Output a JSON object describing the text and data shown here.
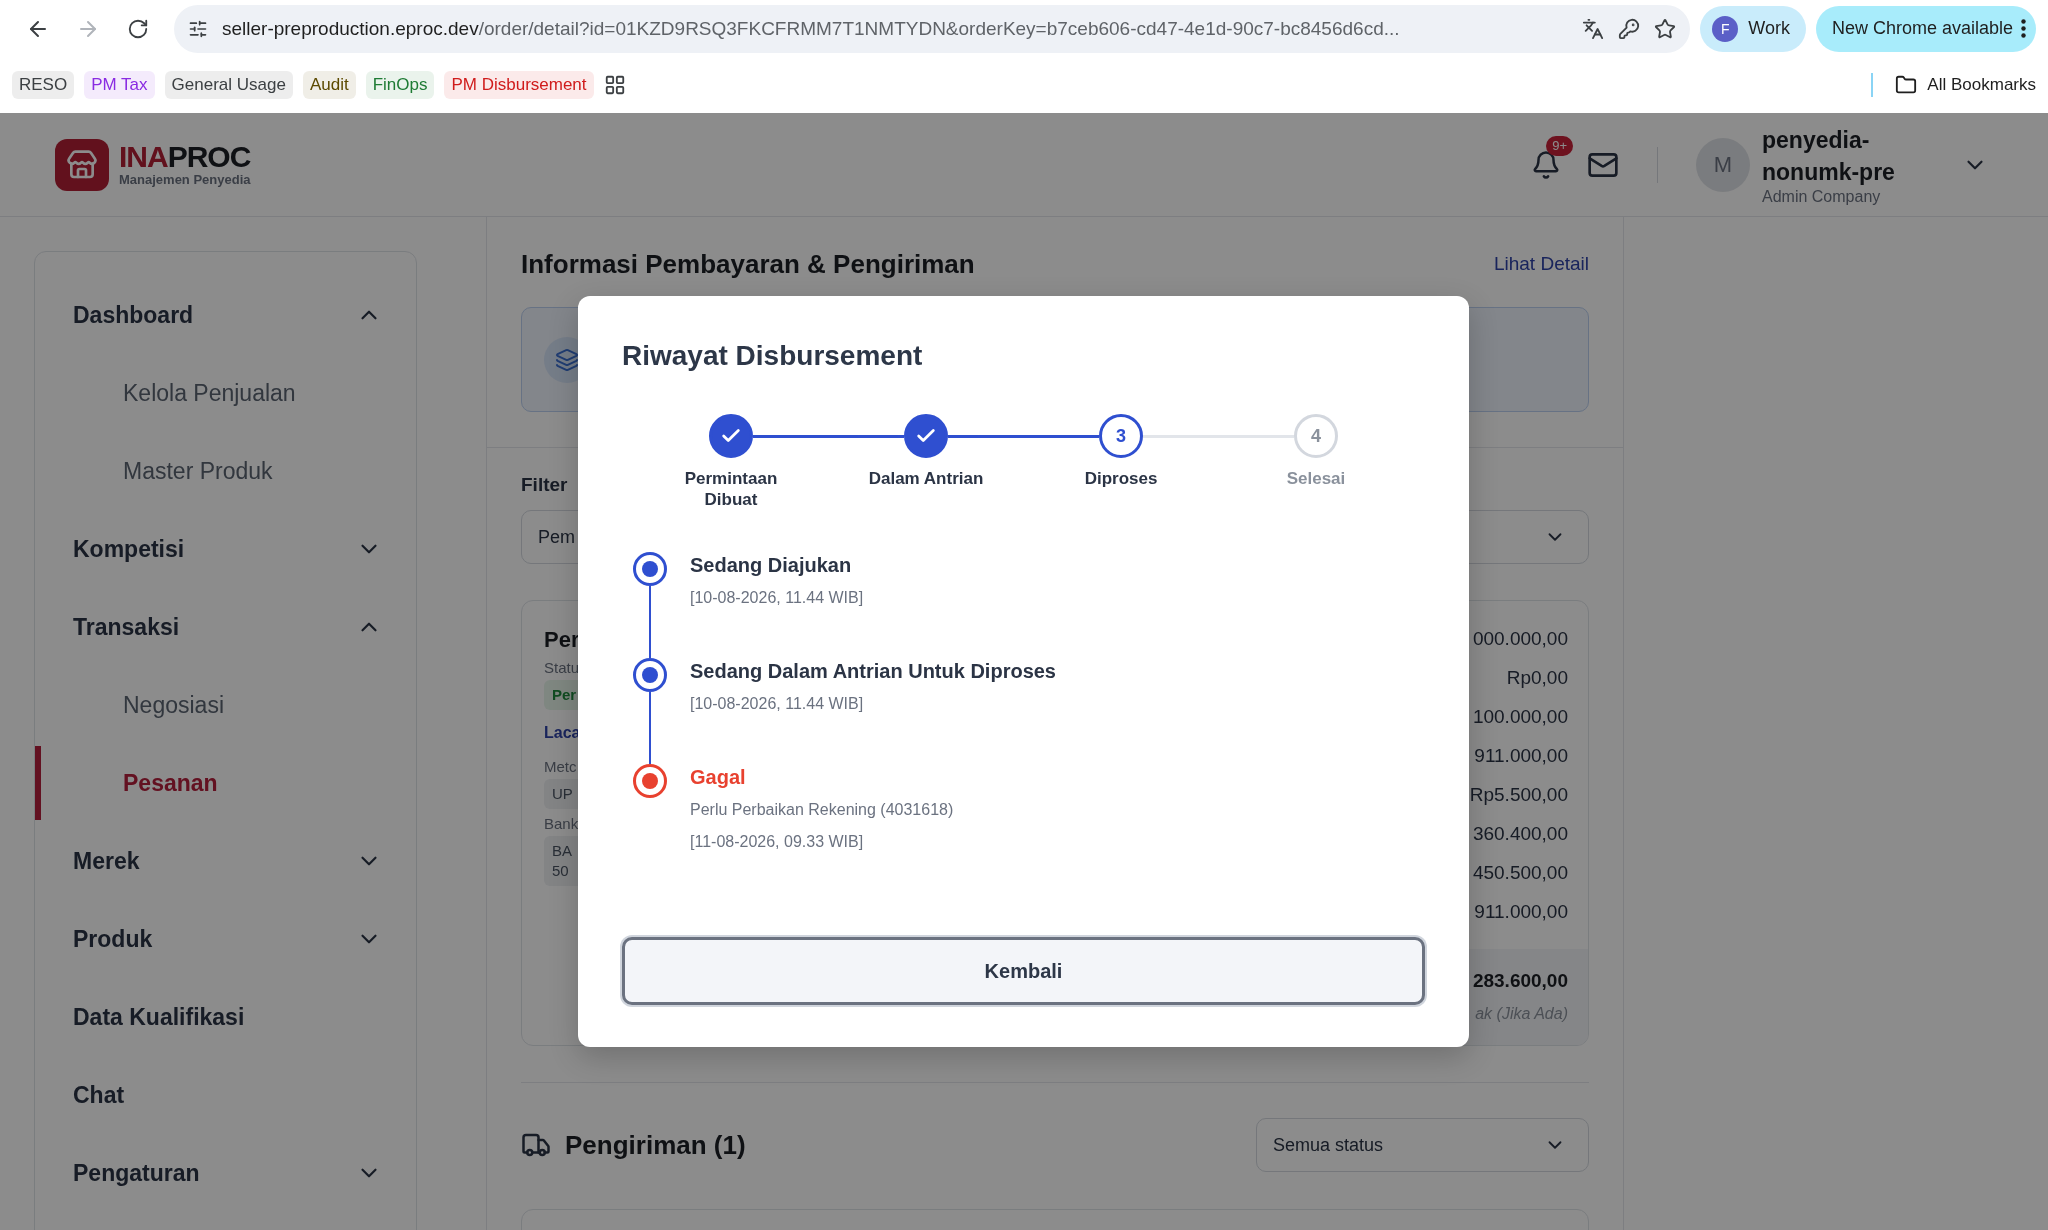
{
  "browser": {
    "url_host": "seller-preproduction.eproc.dev",
    "url_path": "/order/detail?id=01KZD9RSQ3FKCFRMM7T1NMTYDN&orderKey=b7ceb606-cd47-4e1d-90c7-bc8456d6cd...",
    "profile": {
      "initial": "F",
      "name": "Work"
    },
    "update_button": "New Chrome available",
    "bookmarks": [
      {
        "label": "RESO",
        "color": "#3c4043"
      },
      {
        "label": "PM Tax",
        "color": "#8a2be2"
      },
      {
        "label": "General Usage",
        "color": "#3c4043"
      },
      {
        "label": "Audit",
        "color": "#5c4a00"
      },
      {
        "label": "FinOps",
        "color": "#1e7b34"
      },
      {
        "label": "PM Disbursement",
        "color": "#d01c1c"
      }
    ],
    "all_bookmarks": "All Bookmarks"
  },
  "header": {
    "brand_accent": "INA",
    "brand": "PROC",
    "subtitle": "Manajemen Penyedia",
    "notification_badge": "9+",
    "user": {
      "avatar_initial": "M",
      "name": "penyedia-nonumk-pre",
      "role": "Admin Company"
    }
  },
  "sidebar": {
    "items": [
      {
        "label": "Dashboard",
        "kind": "group",
        "expanded": true,
        "selected": false,
        "children": [
          {
            "label": "Kelola Penjualan",
            "selected": false
          },
          {
            "label": "Master Produk",
            "selected": false
          }
        ]
      },
      {
        "label": "Kompetisi",
        "kind": "group",
        "expanded": false,
        "selected": false
      },
      {
        "label": "Transaksi",
        "kind": "group",
        "expanded": true,
        "selected": false,
        "children": [
          {
            "label": "Negosiasi",
            "selected": false
          },
          {
            "label": "Pesanan",
            "selected": true
          }
        ]
      },
      {
        "label": "Merek",
        "kind": "group",
        "expanded": false,
        "selected": false
      },
      {
        "label": "Produk",
        "kind": "group",
        "expanded": false,
        "selected": false
      },
      {
        "label": "Data Kualifikasi",
        "kind": "link",
        "selected": false
      },
      {
        "label": "Chat",
        "kind": "link",
        "selected": false
      },
      {
        "label": "Pengaturan",
        "kind": "group",
        "expanded": false,
        "selected": false
      }
    ]
  },
  "main": {
    "payment_section": {
      "title": "Informasi Pembayaran & Pengiriman",
      "link": "Lihat Detail"
    },
    "filter": {
      "label": "Filter",
      "value": "Pem"
    },
    "summary_card": {
      "title": "Per",
      "status_label": "Statu",
      "status_badge": "Per",
      "track_link": "Laca",
      "method_label": "Metc",
      "method_value": "UP",
      "bank_label": "Bank",
      "bank_value_lines": [
        "BA",
        "50"
      ],
      "amounts": [
        "000.000,00",
        "Rp0,00",
        "100.000,00",
        "911.000,00",
        "Rp5.500,00",
        "360.400,00",
        "450.500,00",
        "911.000,00"
      ],
      "total": "283.600,00",
      "total_note": "ak (Jika Ada)"
    },
    "shipping": {
      "title": "Pengiriman (1)",
      "status_filter": "Semua status"
    }
  },
  "modal": {
    "title": "Riwayat Disbursement",
    "steps": [
      {
        "label": "Permintaan Dibuat",
        "completed": true,
        "active": false
      },
      {
        "label": "Dalam Antrian",
        "completed": true,
        "active": false
      },
      {
        "number": "3",
        "label": "Diproses",
        "completed": false,
        "active": true
      },
      {
        "number": "4",
        "label": "Selesai",
        "completed": false,
        "active": false
      }
    ],
    "events": [
      {
        "title": "Sedang Diajukan",
        "time": "[10-08-2026, 11.44 WIB]",
        "failed": false
      },
      {
        "title": "Sedang Dalam Antrian Untuk Diproses",
        "time": "[10-08-2026, 11.44 WIB]",
        "failed": false
      },
      {
        "title": "Gagal",
        "note": "Perlu Perbaikan Rekening (4031618)",
        "time": "[11-08-2026, 09.33 WIB]",
        "failed": true
      }
    ],
    "close_button": "Kembali"
  }
}
